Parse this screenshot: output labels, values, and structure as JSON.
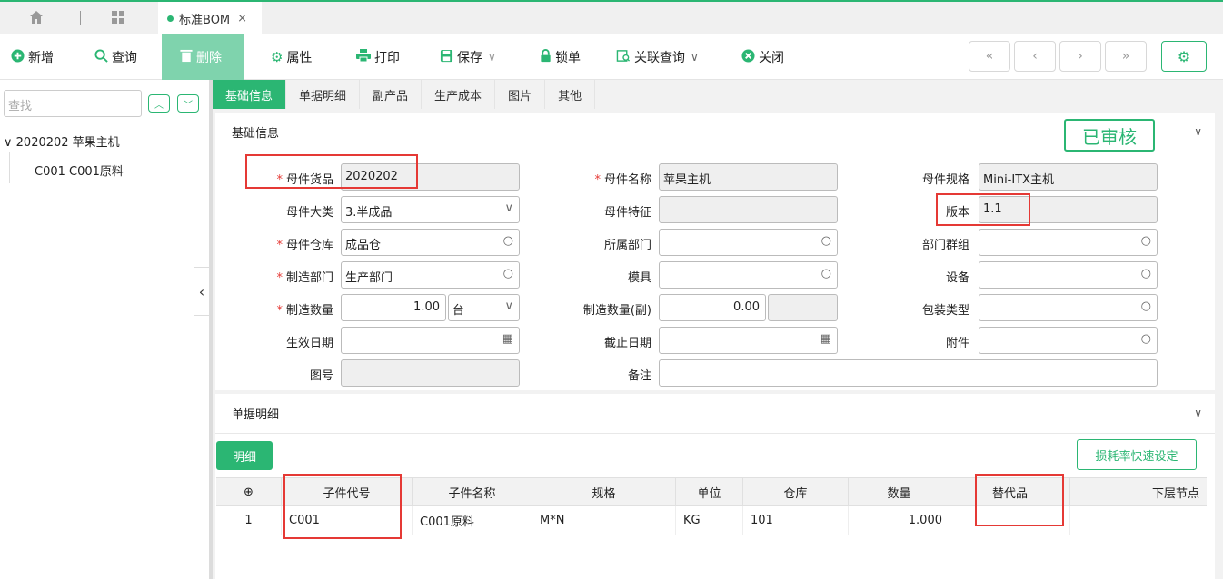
{
  "tabs": {
    "active_label": "标准BOM",
    "close": "×"
  },
  "toolbar": {
    "add": "新增",
    "query": "查询",
    "delete": "删除",
    "attr": "属性",
    "print": "打印",
    "save": "保存",
    "lock": "锁单",
    "related": "关联查询",
    "close": "关闭"
  },
  "nav": {
    "first": "«",
    "prev": "‹",
    "next": "›",
    "last": "»"
  },
  "left": {
    "search_placeholder": "查找",
    "tree_root": "2020202 苹果主机",
    "tree_child": "C001 C001原料"
  },
  "subtabs": [
    "基础信息",
    "单据明细",
    "副产品",
    "生产成本",
    "图片",
    "其他"
  ],
  "basic": {
    "title": "基础信息",
    "status": "已审核",
    "fields": {
      "parent_code_label": "母件货品",
      "parent_code": "2020202",
      "parent_name_label": "母件名称",
      "parent_name": "苹果主机",
      "parent_spec_label": "母件规格",
      "parent_spec": "Mini-ITX主机",
      "category_label": "母件大类",
      "category": "3.半成品",
      "feature_label": "母件特征",
      "feature": "",
      "version_label": "版本",
      "version": "1.1",
      "warehouse_label": "母件仓库",
      "warehouse": "成品仓",
      "dept_label": "所属部门",
      "dept": "",
      "dept_group_label": "部门群组",
      "dept_group": "",
      "mfg_dept_label": "制造部门",
      "mfg_dept": "生产部门",
      "mold_label": "模具",
      "mold": "",
      "equipment_label": "设备",
      "equipment": "",
      "qty_label": "制造数量",
      "qty": "1.00",
      "unit": "台",
      "qty2_label": "制造数量(副)",
      "qty2": "0.00",
      "pack_label": "包装类型",
      "pack": "",
      "eff_date_label": "生效日期",
      "eff_date": "",
      "end_date_label": "截止日期",
      "end_date": "",
      "attach_label": "附件",
      "attach": "",
      "drawing_label": "图号",
      "drawing": "",
      "remark_label": "备注",
      "remark": ""
    }
  },
  "detail": {
    "title": "单据明细",
    "btn_detail": "明细",
    "btn_loss": "损耗率快速设定",
    "add_icon": "⊕",
    "columns": [
      "子件代号",
      "子件名称",
      "规格",
      "单位",
      "仓库",
      "数量",
      "替代品",
      "下层节点"
    ],
    "rows": [
      {
        "no": "1",
        "code": "C001",
        "name": "C001原料",
        "spec": "M*N",
        "unit": "KG",
        "wh": "101",
        "qty": "1.000",
        "sub": "",
        "node": ""
      }
    ]
  },
  "colors": {
    "accent": "#2bb673",
    "highlight": "#e53935"
  }
}
